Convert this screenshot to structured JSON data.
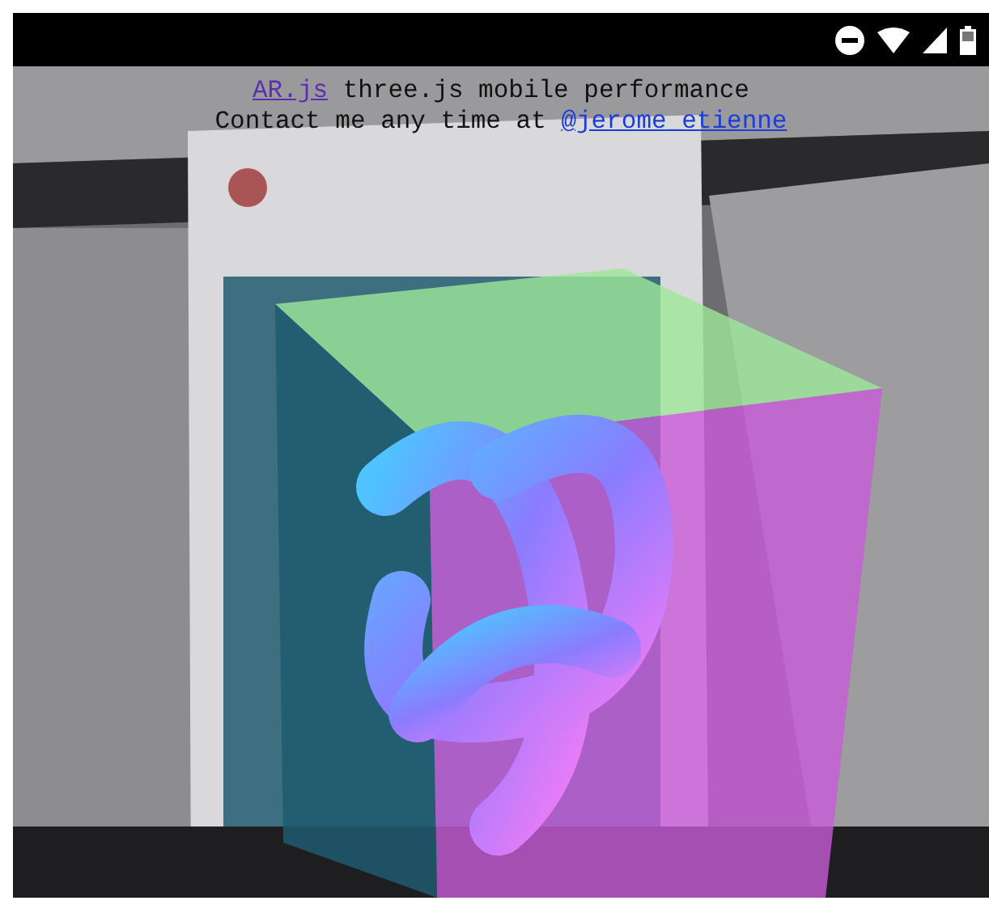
{
  "info": {
    "link": "AR.js",
    "title": "three.js mobile performance",
    "contact_text": "Contact me any time at",
    "contact_link": "@jerome_etienne"
  }
}
